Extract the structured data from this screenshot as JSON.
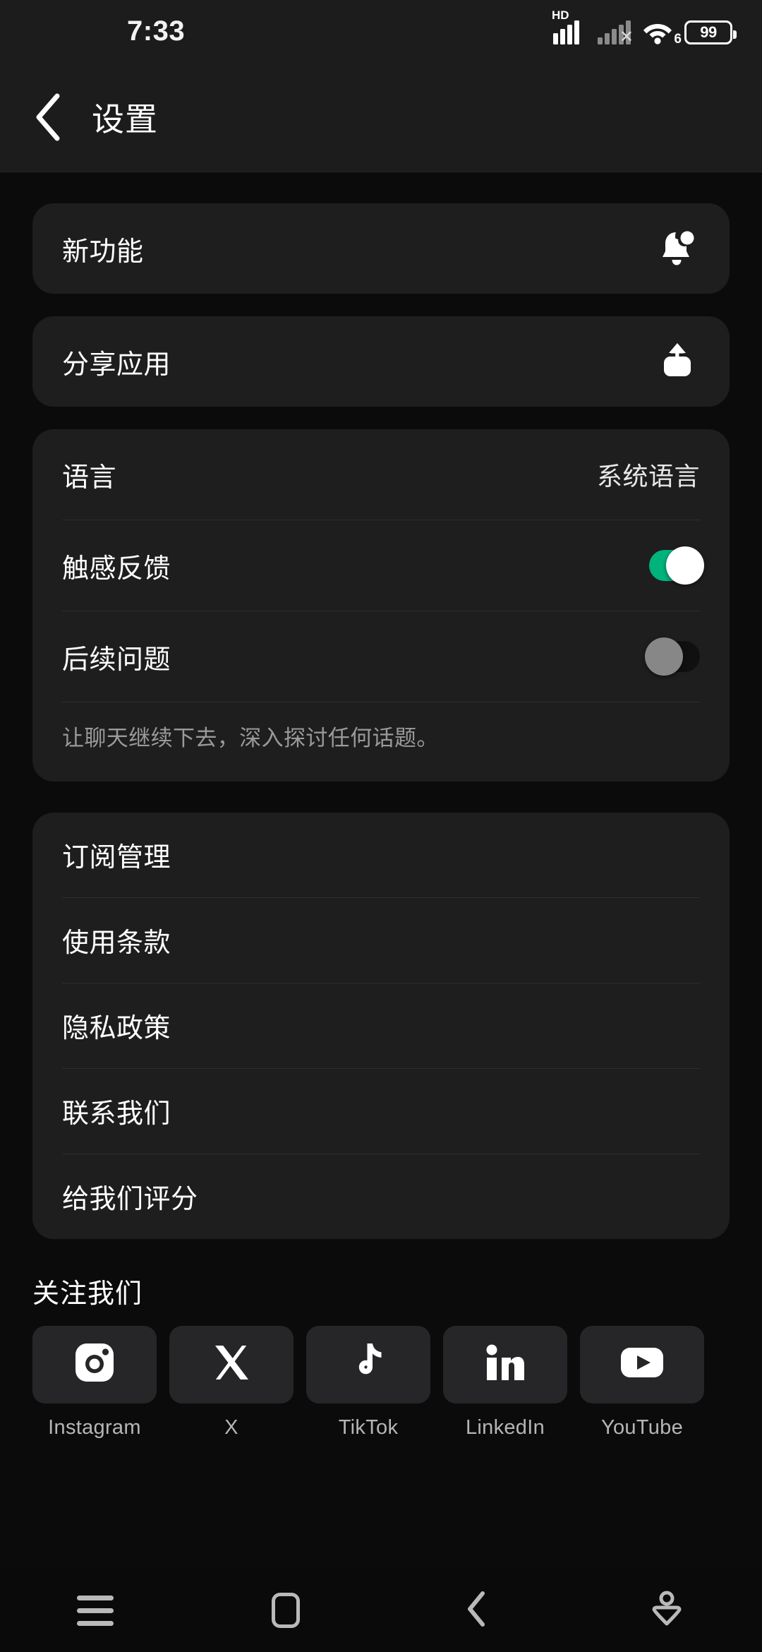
{
  "status_bar": {
    "clock": "7:33",
    "signal_primary_icon": "signal-bars-hd-icon",
    "signal_primary_badge": "HD",
    "signal_secondary_icon": "signal-bars-no-service-icon",
    "signal_secondary_badge": "✕",
    "wifi_icon": "wifi-icon",
    "wifi_generation": "6",
    "battery_icon": "battery-icon",
    "battery_level": "99"
  },
  "app_bar": {
    "back_icon": "chevron-left-icon",
    "title": "设置"
  },
  "cards": {
    "whats_new": {
      "label": "新功能",
      "icon": "bell-notification-icon"
    },
    "share_app": {
      "label": "分享应用",
      "icon": "share-upload-icon"
    },
    "preferences": {
      "language": {
        "label": "语言",
        "value": "系统语言"
      },
      "haptic_feedback": {
        "label": "触感反馈",
        "state": "on"
      },
      "follow_up_questions": {
        "label": "后续问题",
        "state": "off"
      },
      "description": "让聊天继续下去，深入探讨任何话题。"
    },
    "links": [
      {
        "label": "订阅管理"
      },
      {
        "label": "使用条款"
      },
      {
        "label": "隐私政策"
      },
      {
        "label": "联系我们"
      },
      {
        "label": "给我们评分"
      }
    ]
  },
  "follow_us": {
    "title": "关注我们",
    "socials": [
      {
        "name": "Instagram",
        "icon": "instagram-icon"
      },
      {
        "name": "X",
        "icon": "x-twitter-icon"
      },
      {
        "name": "TikTok",
        "icon": "tiktok-icon"
      },
      {
        "name": "LinkedIn",
        "icon": "linkedin-icon"
      },
      {
        "name": "YouTube",
        "icon": "youtube-icon"
      }
    ]
  },
  "nav_bar": {
    "menu_icon": "menu-hamburger-icon",
    "home_icon": "home-square-icon",
    "back_icon": "nav-back-chevron-icon",
    "assistant_icon": "assistant-person-icon"
  },
  "colors": {
    "screen_background": "#0b0b0b",
    "card_background": "#1e1e1e",
    "bar_background": "#1c1c1c",
    "toggle_on": "#00b37c",
    "toggle_off_knob": "#878787",
    "primary_text": "#ffffff",
    "secondary_text": "#9a9a9a"
  }
}
